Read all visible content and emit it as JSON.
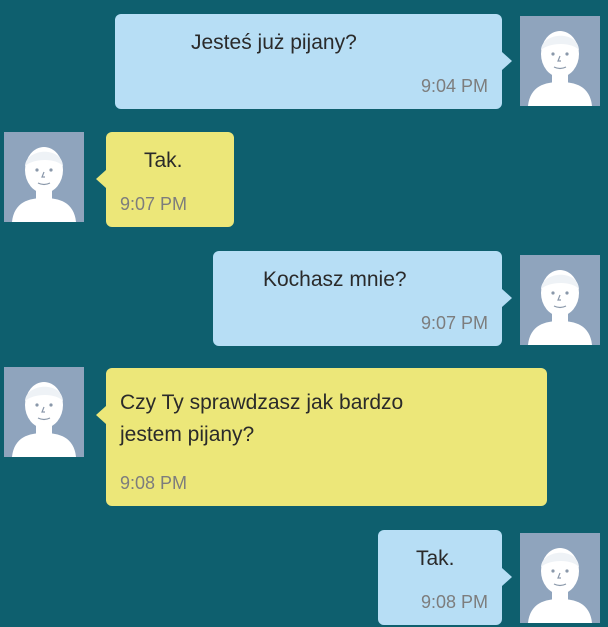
{
  "messages": [
    {
      "sender": "me",
      "lines": [
        "Jesteś już pijany?"
      ],
      "time": "9:04 PM"
    },
    {
      "sender": "them",
      "lines": [
        "Tak."
      ],
      "time": "9:07 PM"
    },
    {
      "sender": "me",
      "lines": [
        "Kochasz mnie?"
      ],
      "time": "9:07 PM"
    },
    {
      "sender": "them",
      "lines": [
        "Czy Ty sprawdzasz jak bardzo",
        "jestem pijany?"
      ],
      "time": "9:08 PM"
    },
    {
      "sender": "me",
      "lines": [
        "Tak."
      ],
      "time": "9:08 PM"
    }
  ],
  "colors": {
    "background": "#0e5f6e",
    "sent_bubble": "#b7def5",
    "received_bubble": "#ece779",
    "avatar_bg": "#8fa4bd",
    "timestamp": "#7d7d7d"
  },
  "icons": {
    "avatar": "default-person-avatar-icon"
  }
}
